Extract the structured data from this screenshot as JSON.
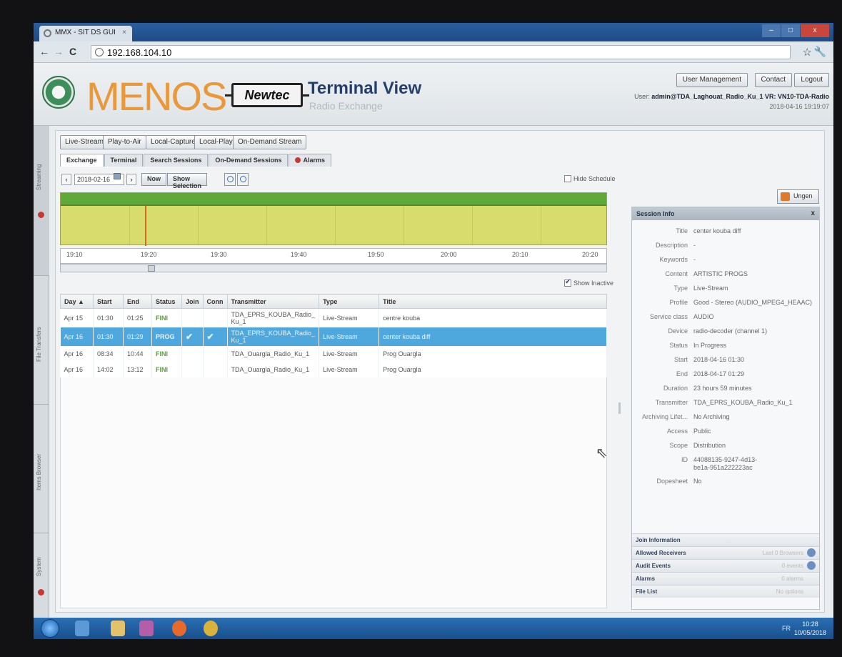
{
  "browser": {
    "tab_title": "MMX - SIT DS GUI",
    "tab_close": "×",
    "url": "192.168.104.10",
    "window_buttons": {
      "minimize": "–",
      "maximize": "□",
      "close": "x"
    }
  },
  "header": {
    "logo_text": "MENOS",
    "newtec_text": "Newtec",
    "title": "Terminal View",
    "subtitle": "Radio Exchange",
    "buttons": {
      "user_management": "User Management",
      "contact": "Contact",
      "logout": "Logout"
    },
    "user_line_prefix": "User: ",
    "user_line": "admin@TDA_Laghouat_Radio_Ku_1 VR: VN10-TDA-Radio",
    "datetime": "2018-04-16 19:19:07"
  },
  "side_tabs": [
    "Streaming",
    "File Transfers",
    "Items Browser",
    "System"
  ],
  "toolbar": {
    "live_stream": "Live-Stream",
    "play_to_air": "Play-to-Air",
    "local_capture": "Local-Capture",
    "local_play": "Local-Play",
    "on_demand_stream": "On-Demand Stream"
  },
  "tabs": [
    "Exchange",
    "Terminal",
    "Search Sessions",
    "On-Demand Sessions",
    "Alarms"
  ],
  "controls": {
    "prev": "‹",
    "next": "›",
    "date": "2018-02-16",
    "now": "Now",
    "show_selection": "Show Selection",
    "hide_schedule": "Hide Schedule",
    "show_inactive": "Show Inactive",
    "ungen": "Ungen"
  },
  "timeline": {
    "ticks": [
      "19:10",
      "19:20",
      "19:30",
      "19:40",
      "19:50",
      "20:00",
      "20:10",
      "20:20"
    ]
  },
  "table": {
    "headers": [
      "Day",
      "Start",
      "End",
      "Status",
      "Join",
      "Conn",
      "Transmitter",
      "Type",
      "Title"
    ],
    "sort_indicator": "▲",
    "rows": [
      {
        "day": "Apr 15",
        "start": "01:30",
        "end": "01:25",
        "status": "FINI",
        "join": "",
        "conn": "",
        "transmitter": "TDA_EPRS_KOUBA_Radio_ Ku_1",
        "type": "Live-Stream",
        "title": "centre kouba"
      },
      {
        "day": "Apr 16",
        "start": "01:30",
        "end": "01:29",
        "status": "PROG",
        "join": "✔",
        "conn": "✔",
        "transmitter": "TDA_EPRS_KOUBA_Radio_ Ku_1",
        "type": "Live-Stream",
        "title": "center kouba diff"
      },
      {
        "day": "Apr 16",
        "start": "08:34",
        "end": "10:44",
        "status": "FINI",
        "join": "",
        "conn": "",
        "transmitter": "TDA_Ouargla_Radio_Ku_1",
        "type": "Live-Stream",
        "title": "Prog Ouargla"
      },
      {
        "day": "Apr 16",
        "start": "14:02",
        "end": "13:12",
        "status": "FINI",
        "join": "",
        "conn": "",
        "transmitter": "TDA_Ouargla_Radio_Ku_1",
        "type": "Live-Stream",
        "title": "Prog Ouargla"
      }
    ]
  },
  "session_info": {
    "heading": "Session Info",
    "close": "x",
    "fields": [
      {
        "k": "Title",
        "v": "center kouba diff"
      },
      {
        "k": "Description",
        "v": "-"
      },
      {
        "k": "Keywords",
        "v": "-"
      },
      {
        "k": "Content",
        "v": "ARTISTIC PROGS"
      },
      {
        "k": "Type",
        "v": "Live-Stream"
      },
      {
        "k": "Profile",
        "v": "Good - Stereo (AUDIO_MPEG4_HEAAC)"
      },
      {
        "k": "Service class",
        "v": "AUDIO"
      },
      {
        "k": "Device",
        "v": "radio-decoder (channel 1)"
      },
      {
        "k": "Status",
        "v": "In Progress"
      },
      {
        "k": "Start",
        "v": "2018-04-16 01:30"
      },
      {
        "k": "End",
        "v": "2018-04-17 01:29"
      },
      {
        "k": "Duration",
        "v": "23 hours 59 minutes"
      },
      {
        "k": "Transmitter",
        "v": "TDA_EPRS_KOUBA_Radio_Ku_1"
      },
      {
        "k": "Archiving Lifet...",
        "v": "No Archiving"
      },
      {
        "k": "Access",
        "v": "Public"
      },
      {
        "k": "Scope",
        "v": "Distribution"
      }
    ],
    "id_label": "ID",
    "id_line1": "44088135-9247-4d13-",
    "id_line2": "be1a-951a222223ac",
    "dopesheet_label": "Dopesheet",
    "dopesheet_value": "No",
    "sections": [
      {
        "label": "Join Information",
        "right": ""
      },
      {
        "label": "Allowed Receivers",
        "right": "Last 0 Browsers"
      },
      {
        "label": "Audit Events",
        "right": "0 events"
      },
      {
        "label": "Alarms",
        "right": "0 alarms"
      },
      {
        "label": "File List",
        "right": "No options"
      }
    ]
  },
  "taskbar": {
    "tray": "FR",
    "time": "10:28",
    "date": "10/05/2018"
  }
}
